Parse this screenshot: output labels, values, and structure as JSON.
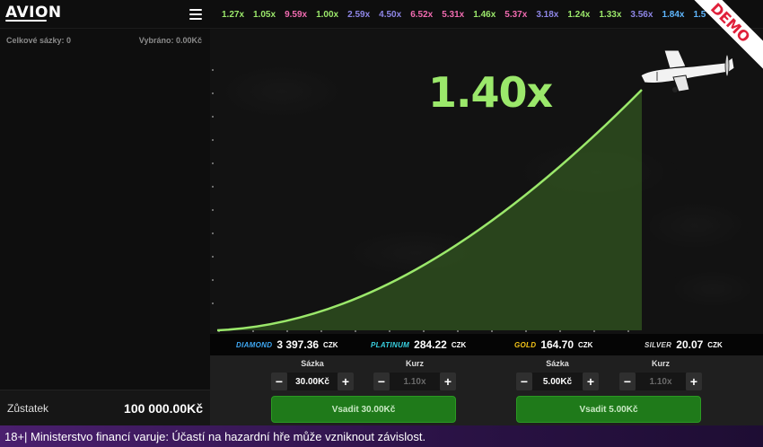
{
  "header": {
    "logo_text": "AVION",
    "menu_icon": "hamburger-menu-icon",
    "history": [
      {
        "value": "1.27x",
        "color": "#9be86b"
      },
      {
        "value": "1.05x",
        "color": "#9be86b"
      },
      {
        "value": "9.59x",
        "color": "#f06bb0"
      },
      {
        "value": "1.00x",
        "color": "#9be86b"
      },
      {
        "value": "2.59x",
        "color": "#8e86e6"
      },
      {
        "value": "4.50x",
        "color": "#8e86e6"
      },
      {
        "value": "6.52x",
        "color": "#f06bb0"
      },
      {
        "value": "5.31x",
        "color": "#f06bb0"
      },
      {
        "value": "1.46x",
        "color": "#9be86b"
      },
      {
        "value": "5.37x",
        "color": "#f06bb0"
      },
      {
        "value": "3.18x",
        "color": "#8e86e6"
      },
      {
        "value": "1.24x",
        "color": "#9be86b"
      },
      {
        "value": "1.33x",
        "color": "#9be86b"
      },
      {
        "value": "3.56x",
        "color": "#8e86e6"
      },
      {
        "value": "1.84x",
        "color": "#5fb7ff"
      },
      {
        "value": "1.5",
        "color": "#5fb7ff"
      }
    ],
    "demo_label": "DEMO"
  },
  "sidebar": {
    "total_bets_label": "Celkové sázky: 0",
    "withdrawn_label": "Vybráno: 0.00Kč",
    "balance_label": "Zůstatek",
    "balance_value": "100 000.00Kč"
  },
  "game": {
    "multiplier": "1.40x",
    "plane_icon": "airplane-icon",
    "curve_color": "#9be86b"
  },
  "jackpots": [
    {
      "tier": "DIAMOND",
      "amount": "3 397.36",
      "currency": "CZK",
      "color": "#3fa9f5"
    },
    {
      "tier": "PLATINUM",
      "amount": "284.22",
      "currency": "CZK",
      "color": "#39d0e0"
    },
    {
      "tier": "GOLD",
      "amount": "164.70",
      "currency": "CZK",
      "color": "#f5c518"
    },
    {
      "tier": "SILVER",
      "amount": "20.07",
      "currency": "CZK",
      "color": "#d8d8d8"
    }
  ],
  "bet_panels": [
    {
      "stake_label": "Sázka",
      "stake_value": "30.00Kč",
      "rate_label": "Kurz",
      "rate_value": "1.10x",
      "bet_button": "Vsadit 30.00Kč",
      "minus": "−",
      "plus": "+"
    },
    {
      "stake_label": "Sázka",
      "stake_value": "5.00Kč",
      "rate_label": "Kurz",
      "rate_value": "1.10x",
      "bet_button": "Vsadit 5.00Kč",
      "minus": "−",
      "plus": "+"
    }
  ],
  "footer": {
    "warning": "18+| Ministerstvo financí varuje: Účastí na hazardní hře může vzniknout závislost."
  }
}
